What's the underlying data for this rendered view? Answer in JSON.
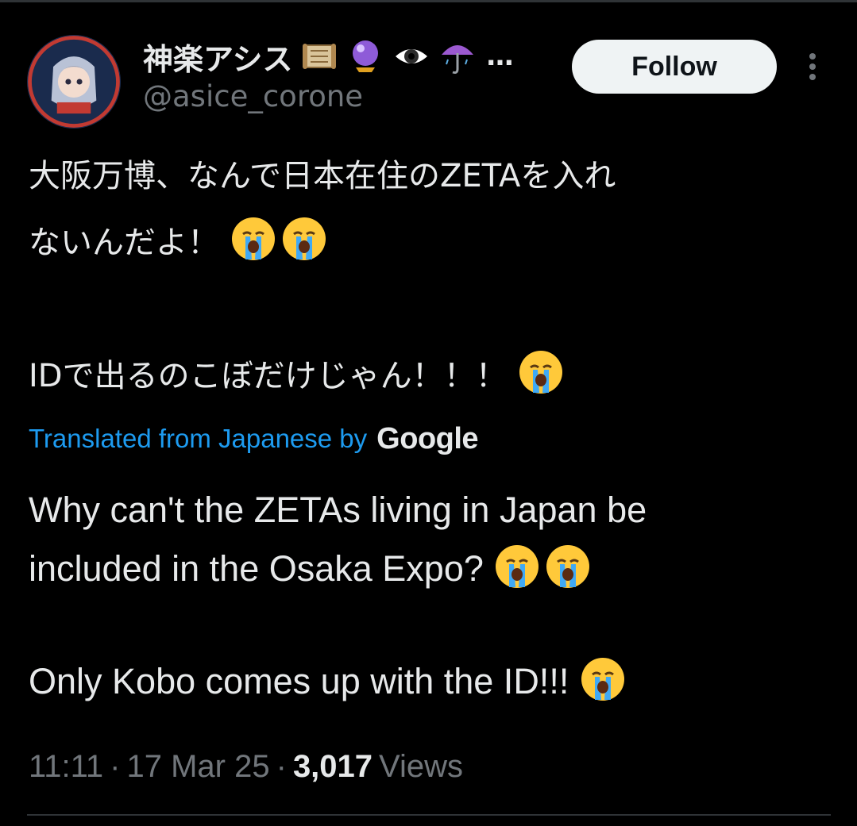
{
  "tweet": {
    "author": {
      "display_name": "神楽アシス",
      "display_name_icons": [
        "scroll-icon",
        "crystal-ball-icon",
        "eye-icon",
        "umbrella-icon"
      ],
      "overflow": "…",
      "handle": "@asice_corone"
    },
    "follow_label": "Follow",
    "original_text": {
      "line1": "大阪万博、なんで日本在住のZETAを入れ",
      "line2": "ないんだよ！",
      "line3": "IDで出るのこぼだけじゃん！！！"
    },
    "translation": {
      "label": "Translated from Japanese by",
      "provider": "Google",
      "line1": "Why can't the ZETAs living in Japan be",
      "line2": "included in the Osaka Expo?",
      "line3": "Only Kobo comes up with the ID!!!"
    },
    "meta": {
      "time": "11:11",
      "separator": "·",
      "date": "17 Mar 25",
      "views_count": "3,017",
      "views_label": "Views"
    }
  },
  "colors": {
    "background": "#000000",
    "text": "#e7e9ea",
    "secondary_text": "#71767b",
    "link": "#1d9bf0",
    "follow_bg": "#eff3f4"
  }
}
